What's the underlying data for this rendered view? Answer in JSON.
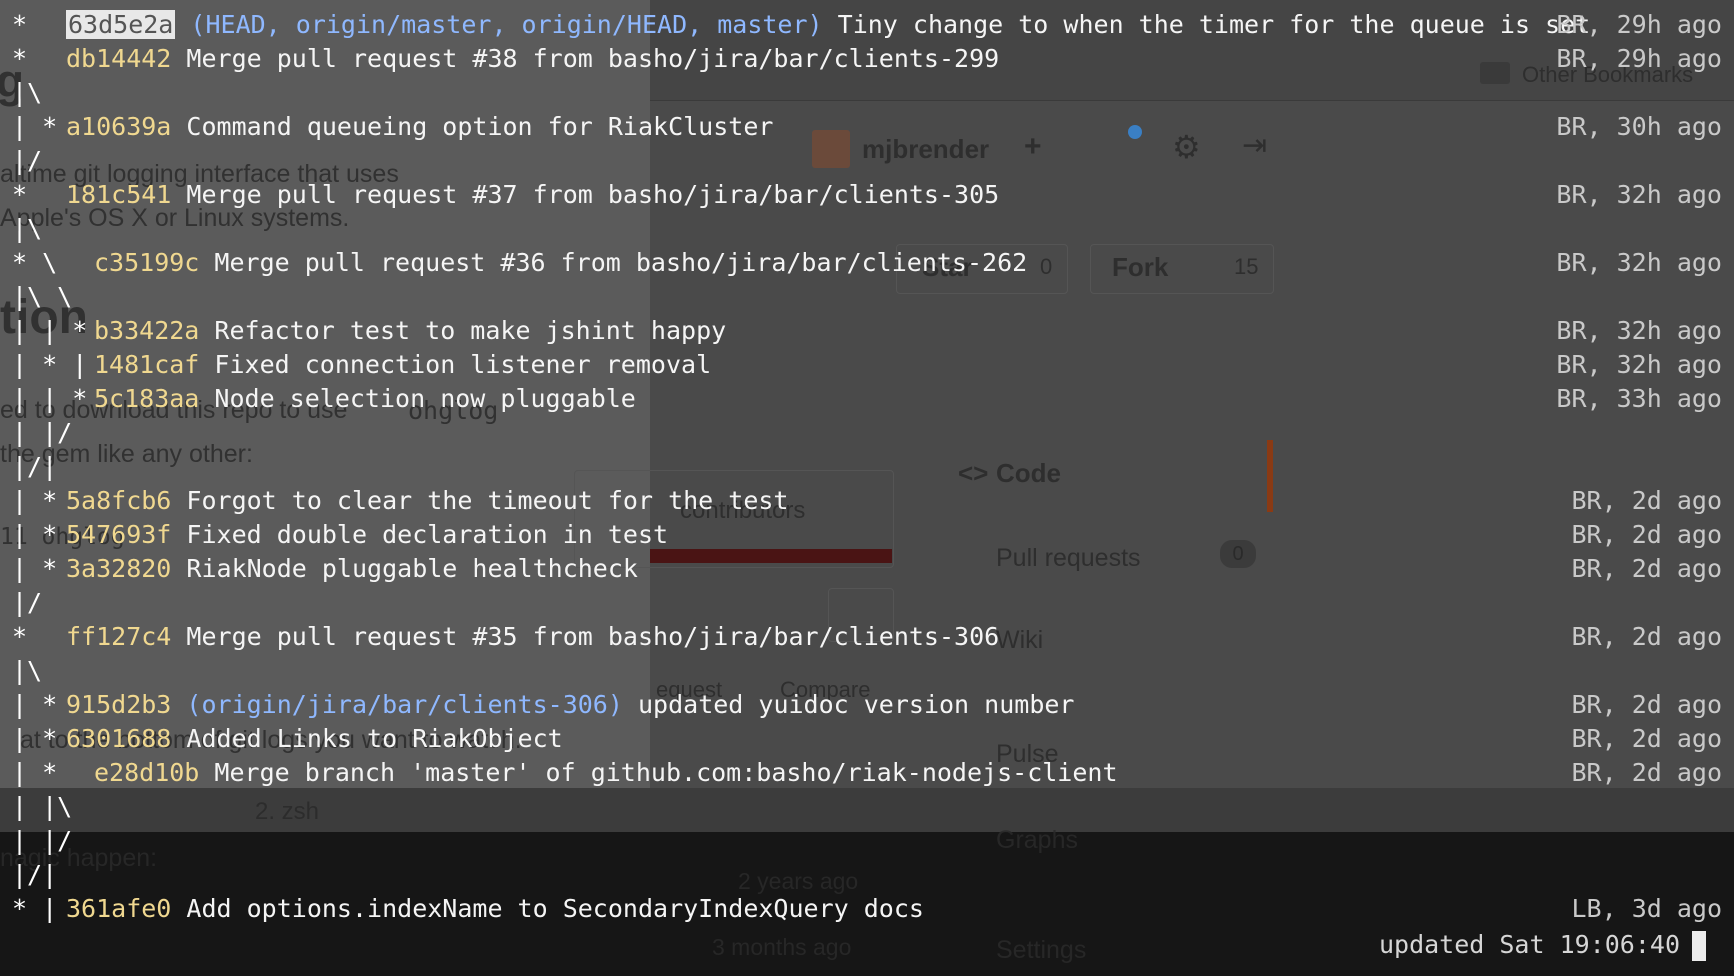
{
  "background": {
    "text_fragments": [
      "g",
      "altime git logging interface that uses",
      "Apple's OS X or Linux systems.",
      "tion",
      "ed to download this repo to use",
      "ohglog",
      "the gem like any other:",
      "11 ohglog",
      "at to the bottom of git logs you want to watch.",
      "2. zsh",
      "nagic happen:",
      "2 years ago",
      "3 months ago",
      "contributors",
      "Other Bookmarks",
      "mjbrender",
      "Star",
      "0",
      "Fork",
      "15",
      "Code",
      "Pull requests",
      "0",
      "Wiki",
      "Pulse",
      "Graphs",
      "Settings",
      "equest",
      "Compare"
    ]
  },
  "log": [
    {
      "graph": "* ",
      "hash": "63d5e2a",
      "refs": "(HEAD, origin/master, origin/HEAD, master)",
      "message": "Tiny change to when the timer for the queue is set",
      "meta": "BR, 29h ago",
      "selected": true
    },
    {
      "graph": "*   ",
      "hash": "db14442",
      "refs": "",
      "message": "Merge pull request #38 from basho/jira/bar/clients-299",
      "meta": "BR, 29h ago"
    },
    {
      "graph_only": "|\\"
    },
    {
      "graph": "| * ",
      "hash": "a10639a",
      "refs": "",
      "message": "Command queueing option for RiakCluster",
      "meta": "BR, 30h ago"
    },
    {
      "graph_only": "|/"
    },
    {
      "graph": "*   ",
      "hash": "181c541",
      "refs": "",
      "message": "Merge pull request #37 from basho/jira/bar/clients-305",
      "meta": "BR, 32h ago"
    },
    {
      "graph_only": "|\\"
    },
    {
      "graph": "* \\   ",
      "hash": "c35199c",
      "refs": "",
      "message": "Merge pull request #36 from basho/jira/bar/clients-262",
      "meta": "BR, 32h ago",
      "wide": true
    },
    {
      "graph_only": "|\\ \\"
    },
    {
      "graph": "| | * ",
      "hash": "b33422a",
      "refs": "",
      "message": "Refactor test to make jshint happy",
      "meta": "BR, 32h ago",
      "wide": true
    },
    {
      "graph": "| * | ",
      "hash": "1481caf",
      "refs": "",
      "message": "Fixed connection listener removal",
      "meta": "BR, 32h ago",
      "wide": true
    },
    {
      "graph": "| | * ",
      "hash": "5c183aa",
      "refs": "",
      "message": "Node selection now pluggable",
      "meta": "BR, 33h ago",
      "wide": true
    },
    {
      "graph_only": "| |/"
    },
    {
      "graph_only": "|/|"
    },
    {
      "graph": "| * ",
      "hash": "5a8fcb6",
      "refs": "",
      "message": "Forgot to clear the timeout for the test",
      "meta": "BR, 2d ago"
    },
    {
      "graph": "| * ",
      "hash": "547693f",
      "refs": "",
      "message": "Fixed double declaration in test",
      "meta": "BR, 2d ago"
    },
    {
      "graph": "| * ",
      "hash": "3a32820",
      "refs": "",
      "message": "RiakNode pluggable healthcheck",
      "meta": "BR, 2d ago"
    },
    {
      "graph_only": "|/"
    },
    {
      "graph": "*   ",
      "hash": "ff127c4",
      "refs": "",
      "message": "Merge pull request #35 from basho/jira/bar/clients-306",
      "meta": "BR, 2d ago"
    },
    {
      "graph_only": "|\\"
    },
    {
      "graph": "| * ",
      "hash": "915d2b3",
      "refs": "(origin/jira/bar/clients-306)",
      "message": "updated yuidoc version number",
      "meta": "BR, 2d ago"
    },
    {
      "graph": "| * ",
      "hash": "6301688",
      "refs": "",
      "message": "Added Links to RiakObject",
      "meta": "BR, 2d ago"
    },
    {
      "graph": "| *   ",
      "hash": "e28d10b",
      "refs": "",
      "message": "Merge branch 'master' of github.com:basho/riak-nodejs-client",
      "meta": "BR, 2d ago",
      "wide": true
    },
    {
      "graph_only": "| |\\"
    },
    {
      "graph_only": "| |/"
    },
    {
      "graph_only": "|/|"
    },
    {
      "graph": "* | ",
      "hash": "361afe0",
      "refs": "",
      "message": "Add options.indexName to SecondaryIndexQuery docs",
      "meta": "LB, 3d ago"
    }
  ],
  "status": {
    "label": "updated Sat 19:06:40"
  }
}
